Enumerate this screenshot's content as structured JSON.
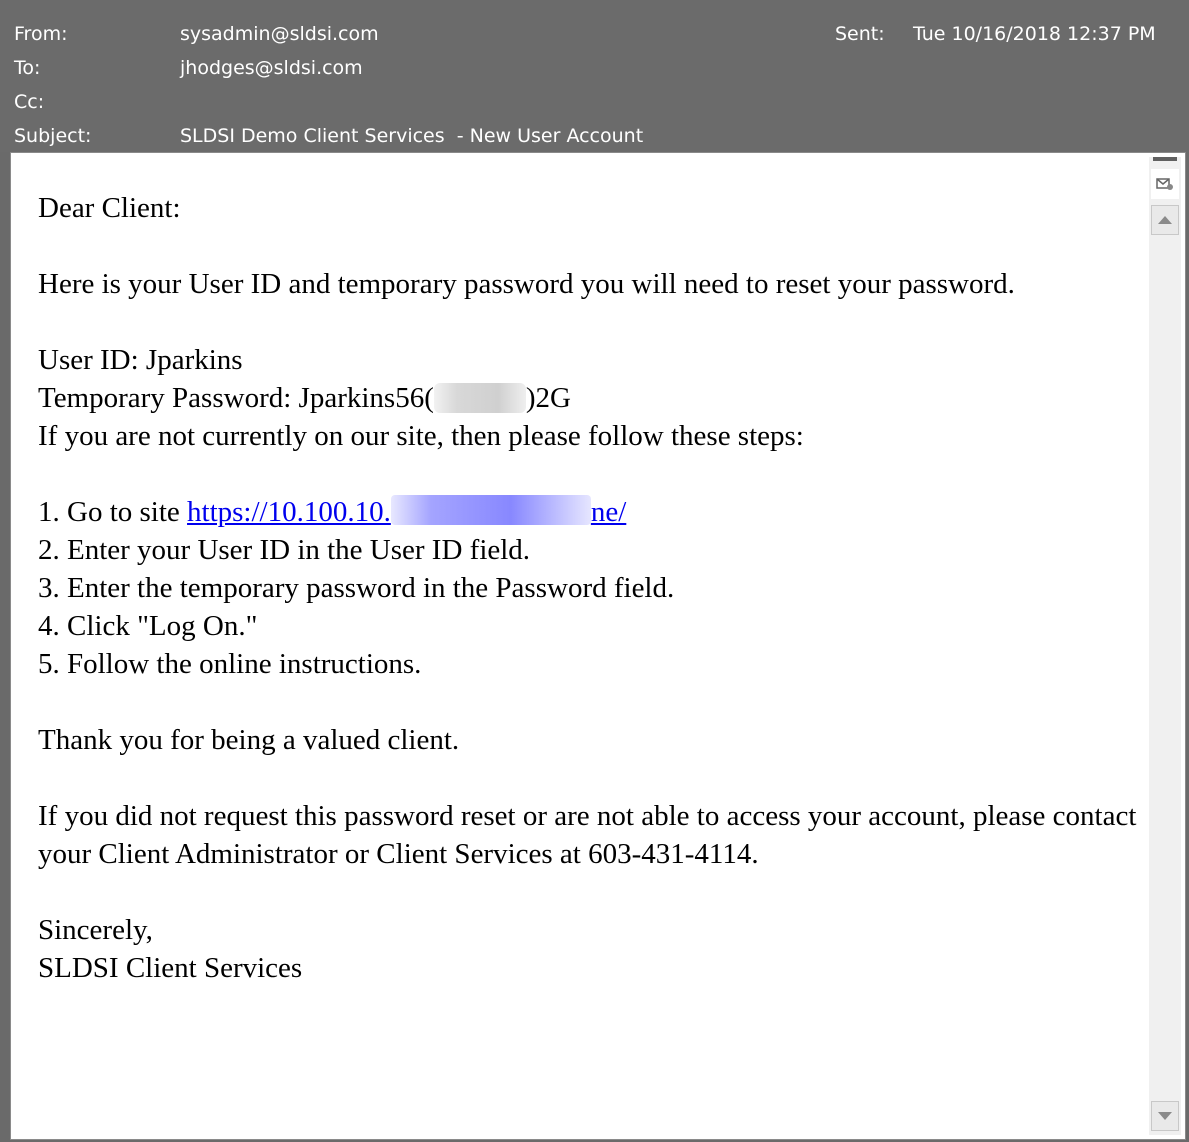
{
  "header": {
    "from_label": "From:",
    "from_value": "sysadmin@sldsi.com",
    "to_label": "To:",
    "to_value": "jhodges@sldsi.com",
    "cc_label": "Cc:",
    "cc_value": "",
    "subject_label": "Subject:",
    "subject_value": "SLDSI Demo Client Services  - New User Account",
    "sent_label": "Sent:",
    "sent_value": "Tue 10/16/2018 12:37 PM"
  },
  "body": {
    "greeting": "Dear Client:",
    "intro": "Here is your User ID and temporary password you will need to reset your password.",
    "user_id": "User ID: Jparkins",
    "temp_password_prefix": "Temporary Password: Jparkins56(",
    "temp_password_suffix": ")2G",
    "steps_intro": "If you are not currently on our site, then please follow these steps:",
    "step1_prefix": "1. Go to site ",
    "step1_link_start": "https://10.100.10.",
    "step1_link_end": "ne/",
    "step2": "2. Enter your User ID in the User ID field.",
    "step3": "3. Enter the temporary password in the Password field.",
    "step4": "4. Click \"Log On.\"",
    "step5": "5. Follow the online instructions.",
    "thanks": "Thank you for being a valued client.",
    "contact": "If you did not request this password reset or are not able to access your account, please contact your Client Administrator or Client Services at 603-431-4114.",
    "closing": "Sincerely,",
    "signature": "SLDSI Client Services"
  },
  "scrollbar": {
    "menu_icon": "envelope-settings-icon",
    "up_icon": "arrow-up-icon",
    "down_icon": "arrow-down-icon"
  },
  "colors": {
    "header_bg": "#6b6b6b",
    "header_text": "#ffffff",
    "link": "#0000ee"
  }
}
